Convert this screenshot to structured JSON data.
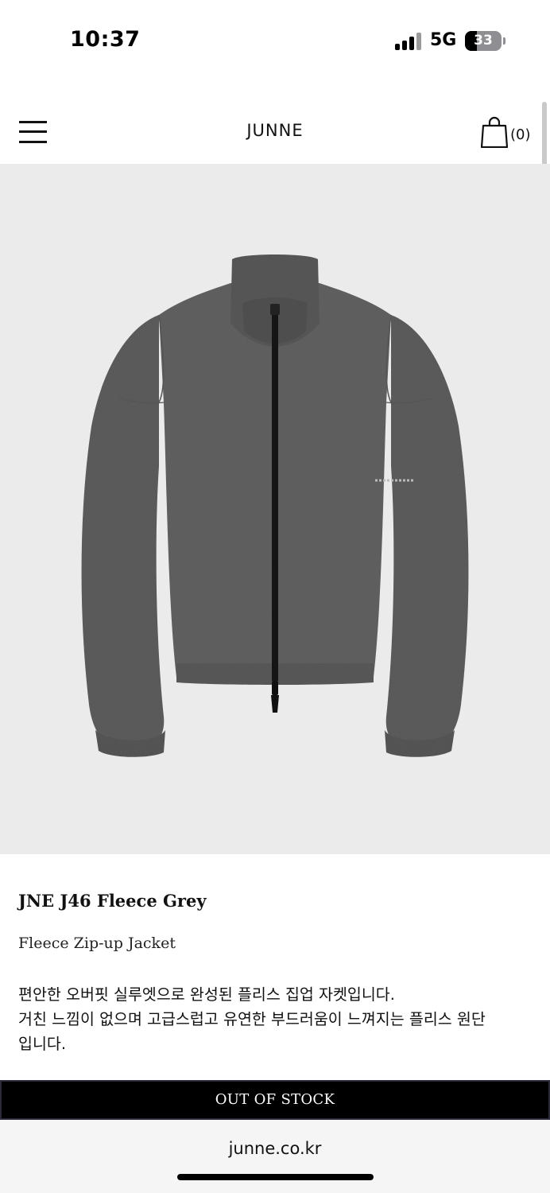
{
  "status_bar": {
    "time": "10:37",
    "network": "5G",
    "battery": "33",
    "battery_level": 0.33
  },
  "header": {
    "brand": "JUNNE",
    "menu_icon": "hamburger-menu-icon",
    "cart_icon": "shopping-bag-icon",
    "cart_count": "(0)"
  },
  "product": {
    "image_alt": "grey-fleece-zip-up-jacket",
    "image_background": "#ebebeb",
    "jacket_color": "#5e5e5e",
    "name": "JNE J46 Fleece Grey",
    "subtitle": "Fleece Zip-up Jacket",
    "description_lines": [
      "편안한 오버핏 실루엣으로 완성된 플리스 집업 자켓입니다.",
      "거친 느낌이 없으며 고급스럽고 유연한 부드러움이 느껴지는 플리스 원단",
      "입니다."
    ]
  },
  "action": {
    "button_label": "OUT OF STOCK"
  },
  "browser": {
    "url": "junne.co.kr"
  }
}
